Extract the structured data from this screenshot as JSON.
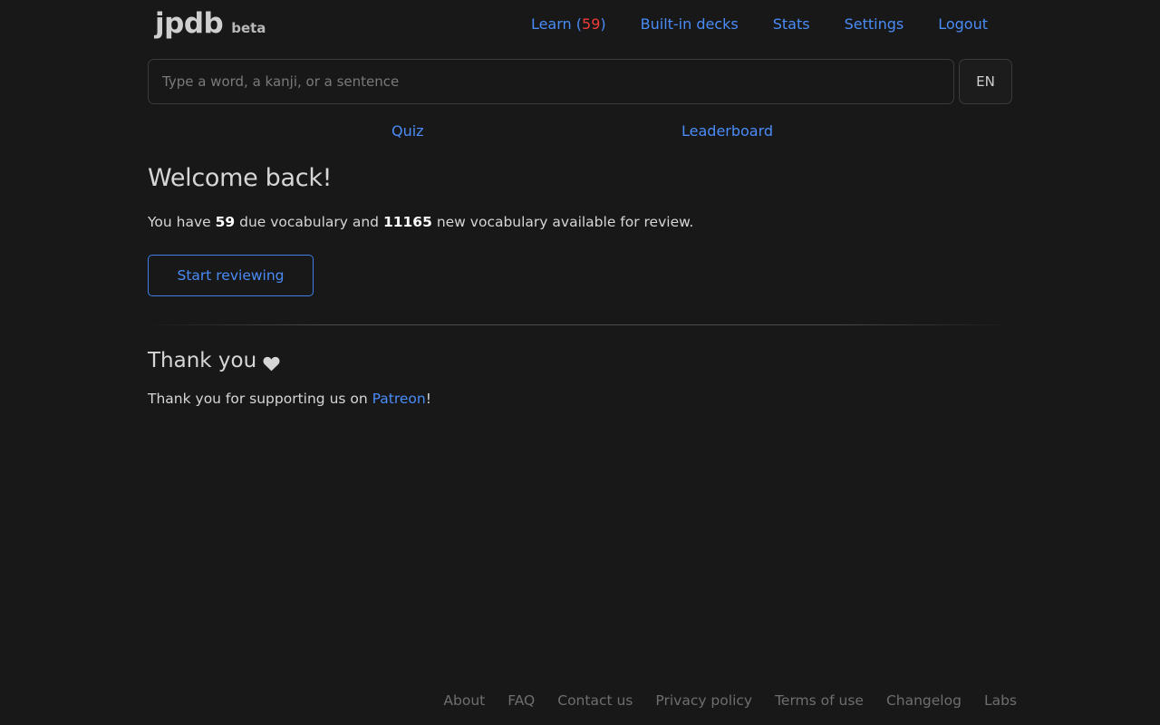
{
  "header": {
    "logo": "jpdb",
    "logo_tag": "beta",
    "nav": {
      "learn_label": "Learn",
      "learn_open": "(",
      "learn_count": "59",
      "learn_close": ")",
      "builtin_decks": "Built-in decks",
      "stats": "Stats",
      "settings": "Settings",
      "logout": "Logout"
    }
  },
  "search": {
    "placeholder": "Type a word, a kanji, or a sentence",
    "value": "",
    "lang_button": "EN"
  },
  "sub_links": {
    "quiz": "Quiz",
    "leaderboard": "Leaderboard"
  },
  "welcome": {
    "title": "Welcome back!",
    "text_prefix": "You have ",
    "due_count": "59",
    "text_middle": " due vocabulary and ",
    "new_count": "11165",
    "text_suffix": " new vocabulary available for review.",
    "start_button": "Start reviewing"
  },
  "thanks": {
    "title": "Thank you",
    "icon": "heart-icon",
    "text_prefix": "Thank you for supporting us on ",
    "link": "Patreon",
    "text_suffix": "!"
  },
  "footer": {
    "links": [
      "About",
      "FAQ",
      "Contact us",
      "Privacy policy",
      "Terms of use",
      "Changelog",
      "Labs"
    ]
  },
  "colors": {
    "background": "#181818",
    "link": "#4a8cf7",
    "count_red": "#f03c3c",
    "footer_link": "#6e6e6e"
  }
}
